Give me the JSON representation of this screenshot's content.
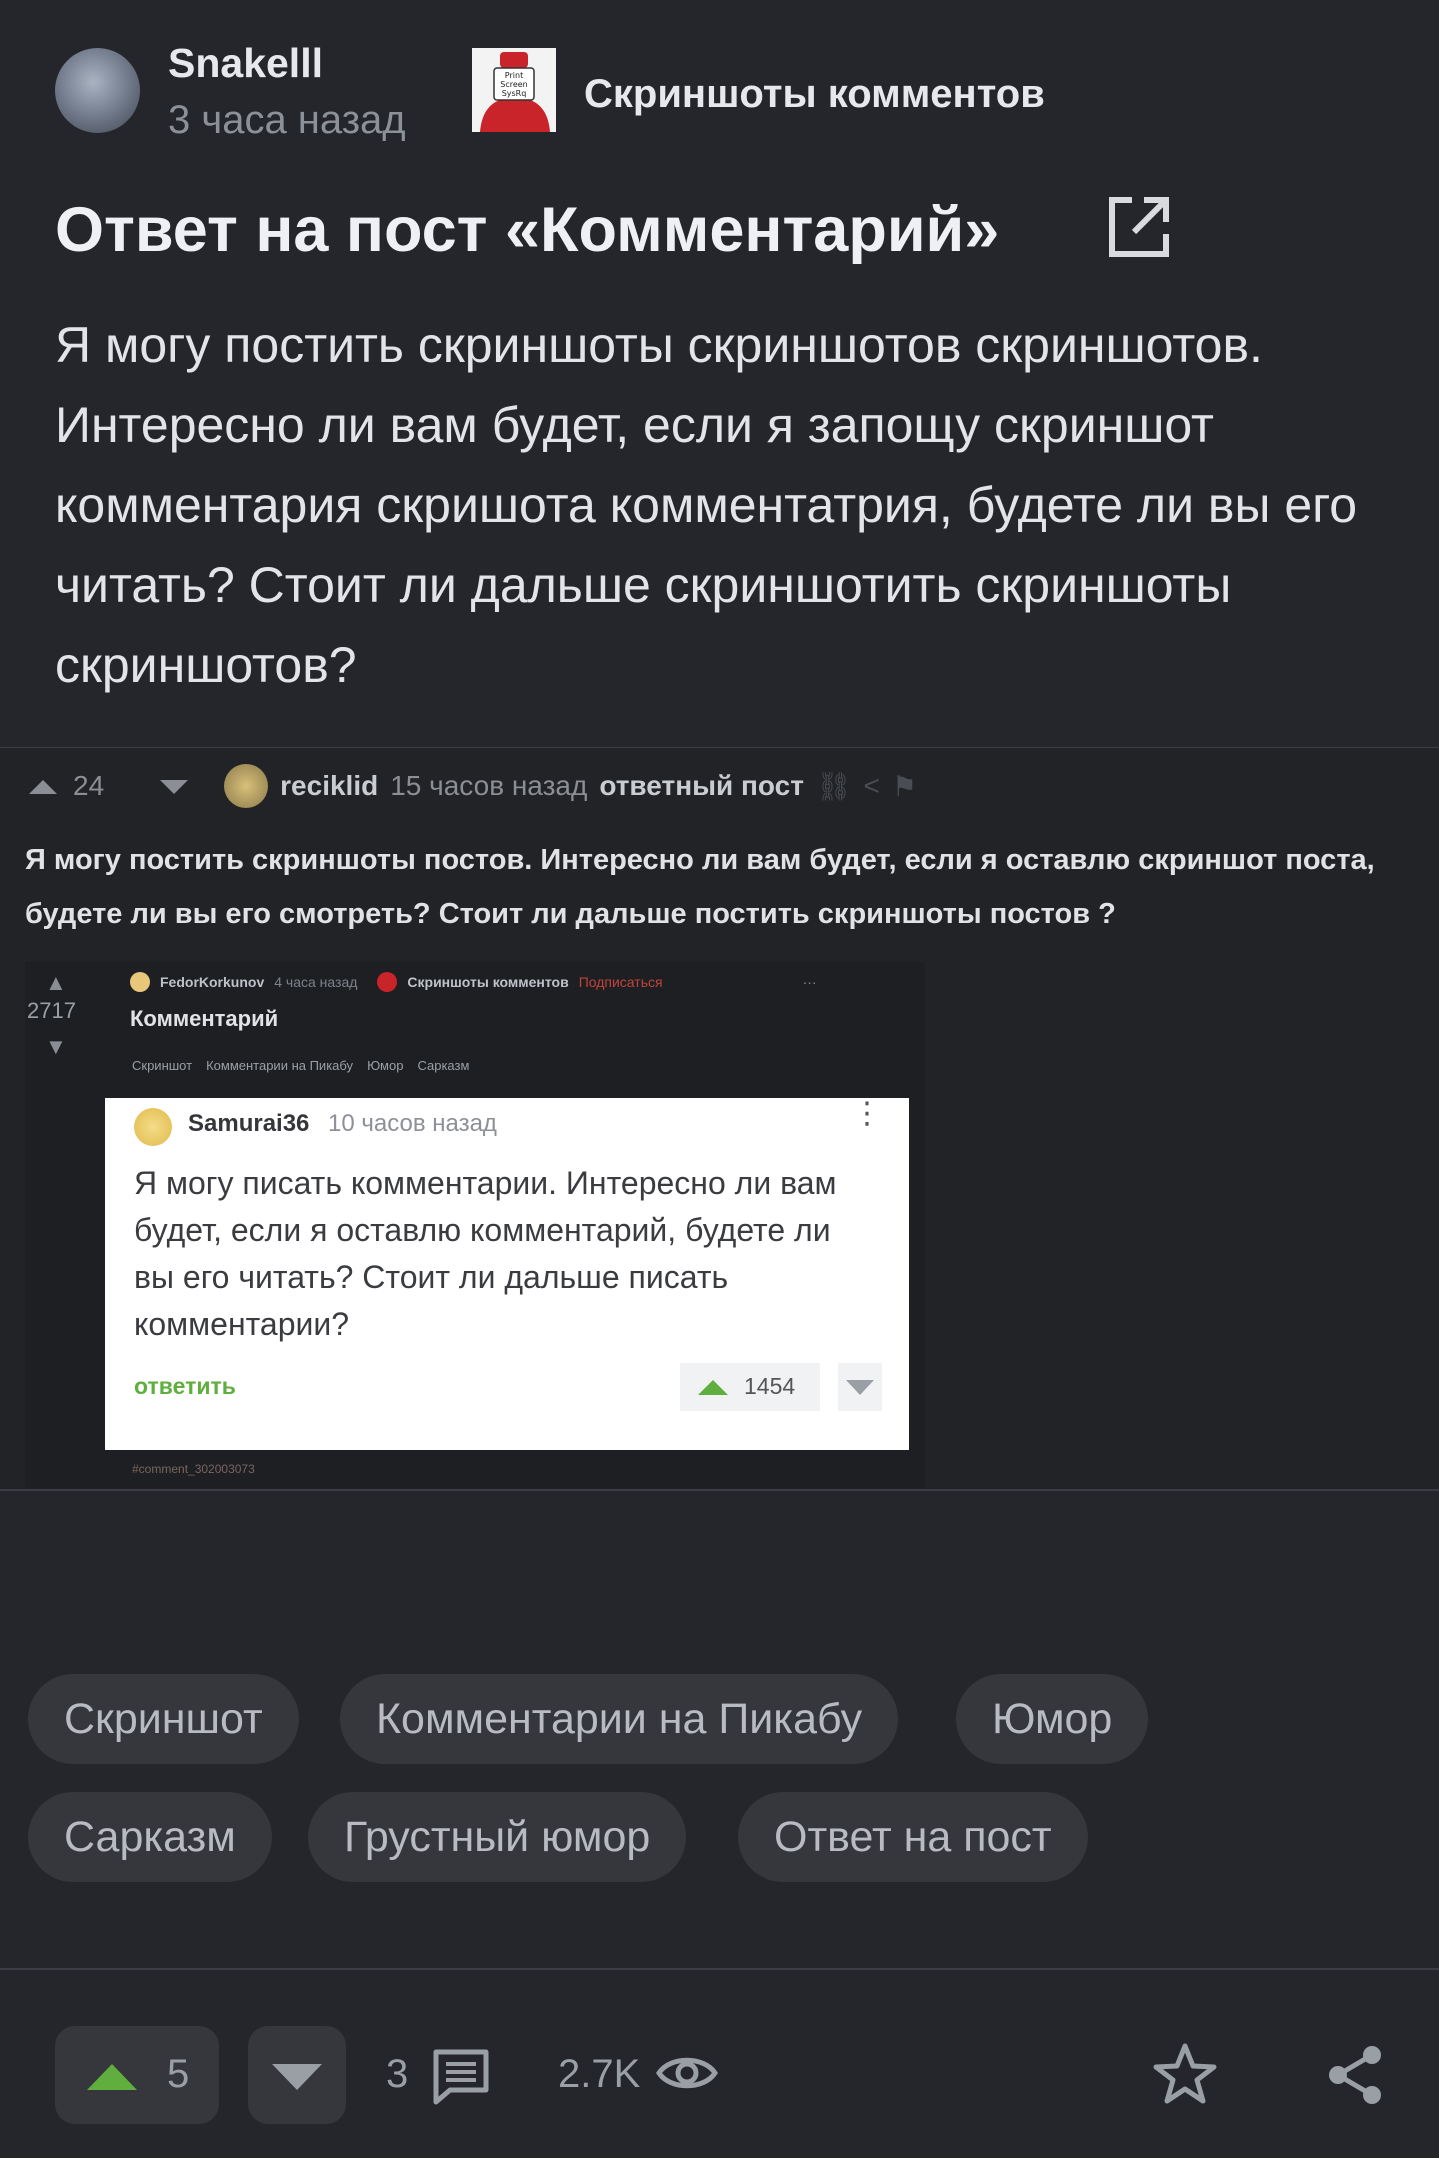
{
  "post": {
    "author": "Snakelll",
    "time": "3 часа назад",
    "community": "Скриншоты комментов",
    "community_thumb_text": "Print Screen SysRq",
    "title": "Ответ на пост «Комментарий»",
    "body": "Я могу постить скриншоты скриншотов скриншотов. Интересно ли вам будет, если я запощу скриншот комментария скришота комментатрия, будете ли вы его читать? Стоит ли дальше скриншотить скриншоты скриншотов?"
  },
  "screenshot": {
    "votes": "24",
    "user": "reciklid",
    "time": "15 часов назад",
    "label": "ответный пост",
    "text": "Я могу постить скриншоты постов. Интересно ли вам будет, если я оставлю скриншот поста, будете ли вы его смотреть? Стоит ли дальше постить скриншоты постов ?",
    "nested": {
      "votes": "2717",
      "user": "FedorKorkunov",
      "time": "4 часа назад",
      "community": "Скриншоты комментов",
      "subscribe": "Подписаться",
      "title": "Комментарий",
      "tags": [
        "Скриншот",
        "Комментарии на Пикабу",
        "Юмор",
        "Сарказм"
      ],
      "comment_user": "Samurai36",
      "comment_time": "10 часов назад",
      "comment_text": "Я могу писать комментарии. Интересно ли вам будет, если я оставлю комментарий, будете ли вы его читать? Стоит ли дальше писать комментарии?",
      "reply": "ответить",
      "comment_votes": "1454",
      "footer": "#comment_302003073"
    }
  },
  "tags": [
    "Скриншот",
    "Комментарии на Пикабу",
    "Юмор",
    "Сарказм",
    "Грустный юмор",
    "Ответ на пост"
  ],
  "bottom": {
    "rating": "5",
    "comments": "3",
    "views": "2.7K"
  },
  "colors": {
    "background": "#24262b",
    "upvote_green": "#5fae3e",
    "chip": "#35373c"
  }
}
